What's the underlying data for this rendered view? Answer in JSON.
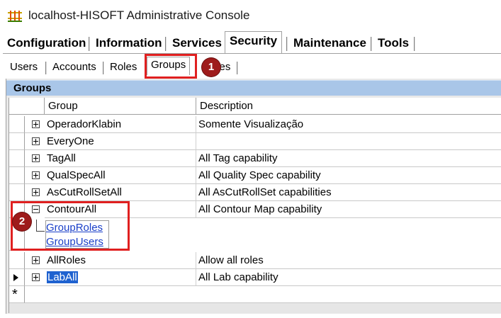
{
  "window": {
    "title": "localhost-HISOFT Administrative Console",
    "icon": "hisoft-app-icon"
  },
  "main_tabs": [
    {
      "label": "Configuration",
      "selected": false
    },
    {
      "label": "Information",
      "selected": false
    },
    {
      "label": "Services",
      "selected": false
    },
    {
      "label": "Security",
      "selected": true
    },
    {
      "label": "Maintenance",
      "selected": false
    },
    {
      "label": "Tools",
      "selected": false
    }
  ],
  "sub_tabs": [
    {
      "label": "Users",
      "selected": false
    },
    {
      "label": "Accounts",
      "selected": false
    },
    {
      "label": "Roles",
      "selected": false
    },
    {
      "label": "Groups",
      "selected": true
    },
    {
      "label": "Rules",
      "selected": false
    }
  ],
  "panel": {
    "title": "Groups"
  },
  "grid": {
    "columns": [
      "Group",
      "Description"
    ],
    "rows": [
      {
        "group": "OperadorKlabin",
        "description": "Somente Visualização",
        "expanded": false
      },
      {
        "group": "EveryOne",
        "description": "",
        "expanded": false
      },
      {
        "group": "TagAll",
        "description": "All Tag capability",
        "expanded": false
      },
      {
        "group": "QualSpecAll",
        "description": "All Quality Spec capability",
        "expanded": false
      },
      {
        "group": "AsCutRollSetAll",
        "description": "All AsCutRollSet capabilities",
        "expanded": false
      },
      {
        "group": "ContourAll",
        "description": "All Contour Map capability",
        "expanded": true
      },
      {
        "group": "AllRoles",
        "description": "Allow all roles",
        "expanded": false
      },
      {
        "group": "LabAll",
        "description": "All Lab capability",
        "expanded": false,
        "current": true
      }
    ],
    "child_relations": [
      "GroupRoles",
      "GroupUsers"
    ],
    "new_row_marker": "*"
  },
  "annotations": {
    "badge_1": "1",
    "badge_2": "2",
    "callout_color": "#e02020",
    "badge_color": "#9e1b1b"
  },
  "colors": {
    "panel_header": "#a9c6e8",
    "selection": "#1f62d0",
    "link": "#1a3fc8"
  }
}
